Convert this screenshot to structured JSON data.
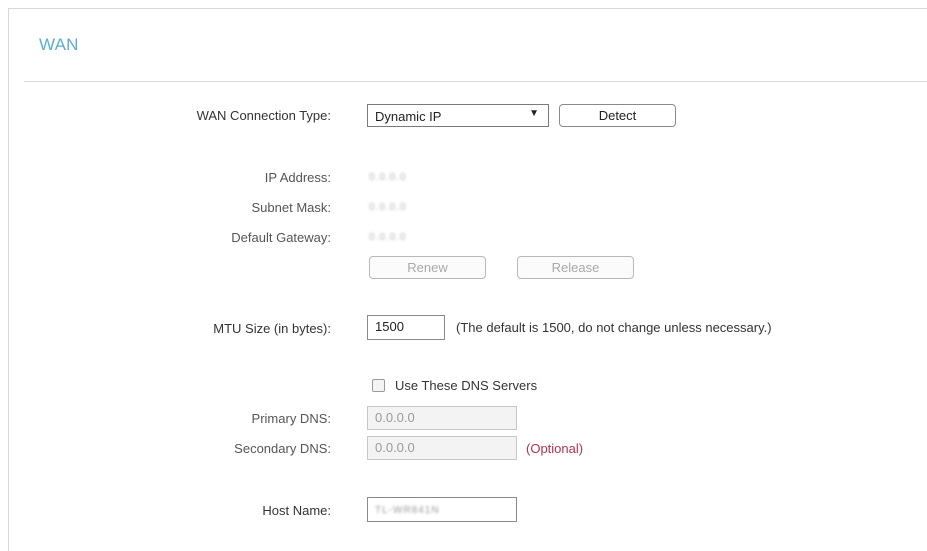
{
  "section": {
    "title": "WAN"
  },
  "connection_type": {
    "label": "WAN Connection Type:",
    "selected": "Dynamic IP",
    "arrow": "▼",
    "detect_button": "Detect"
  },
  "status": {
    "ip_label": "IP Address:",
    "ip_value": "0.0.0.0",
    "subnet_label": "Subnet Mask:",
    "subnet_value": "0.0.0.0",
    "gateway_label": "Default Gateway:",
    "gateway_value": "0.0.0.0",
    "renew_button": "Renew",
    "release_button": "Release"
  },
  "mtu": {
    "label": "MTU Size (in bytes):",
    "value": "1500",
    "hint": "(The default is 1500, do not change unless necessary.)"
  },
  "dns": {
    "checkbox_label": "Use These DNS Servers",
    "checked": false,
    "primary_label": "Primary DNS:",
    "primary_value": "0.0.0.0",
    "secondary_label": "Secondary DNS:",
    "secondary_value": "0.0.0.0",
    "optional_text": "(Optional)"
  },
  "host": {
    "label": "Host Name:",
    "value": "TL-WR841N"
  },
  "colors": {
    "title": "#5aaed4",
    "optional": "#b0334a"
  }
}
